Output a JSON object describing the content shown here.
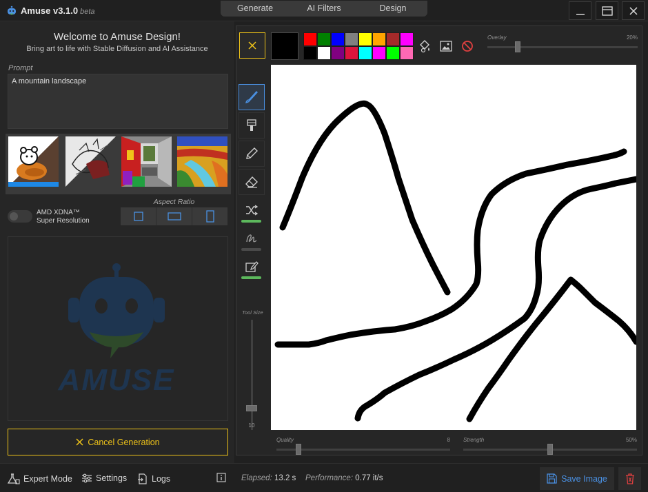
{
  "titlebar": {
    "app_name": "Amuse v3.1.0",
    "app_tag": "beta",
    "tabs": [
      {
        "label": "Generate"
      },
      {
        "label": "AI Filters"
      },
      {
        "label": "Design"
      }
    ]
  },
  "left": {
    "welcome_title": "Welcome to Amuse Design!",
    "welcome_subtitle": "Bring art to life with Stable Diffusion and AI Assistance",
    "prompt_label": "Prompt",
    "prompt_value": "A mountain landscape",
    "xdna_label_line1": "AMD XDNA™",
    "xdna_label_line2": "Super Resolution",
    "aspect_label": "Aspect Ratio",
    "watermark_text": "AMUSE",
    "cancel_label": "Cancel Generation"
  },
  "toolbar": {
    "current_color": "#000000",
    "palette": [
      "#ff0000",
      "#008000",
      "#0000ff",
      "#808080",
      "#ffff00",
      "#ffa500",
      "#a52a2a",
      "#ff00ff",
      "#000000",
      "#ffffff",
      "#800080",
      "#dc143c",
      "#00ffff",
      "#ff00ff",
      "#00ff00",
      "#ff69b4"
    ],
    "overlay_label": "Overlay",
    "overlay_value": "20%",
    "overlay_level": 0.2
  },
  "tools": {
    "tool_size_label": "Tool Size",
    "tool_size_value": "10"
  },
  "bottom_sliders": {
    "quality_label": "Quality",
    "quality_value": "8",
    "strength_label": "Strength",
    "strength_value": "50%",
    "strength_level": 0.5
  },
  "statusbar": {
    "expert_mode": "Expert Mode",
    "settings": "Settings",
    "logs": "Logs",
    "elapsed_label": "Elapsed:",
    "elapsed_value": "13.2 s",
    "performance_label": "Performance:",
    "performance_value": "0.77 it/s",
    "save_label": "Save Image"
  },
  "colors": {
    "accent_yellow": "#f0c419",
    "accent_blue": "#4a90e2",
    "accent_green": "#5cb85c",
    "delete_red": "#e04040"
  }
}
